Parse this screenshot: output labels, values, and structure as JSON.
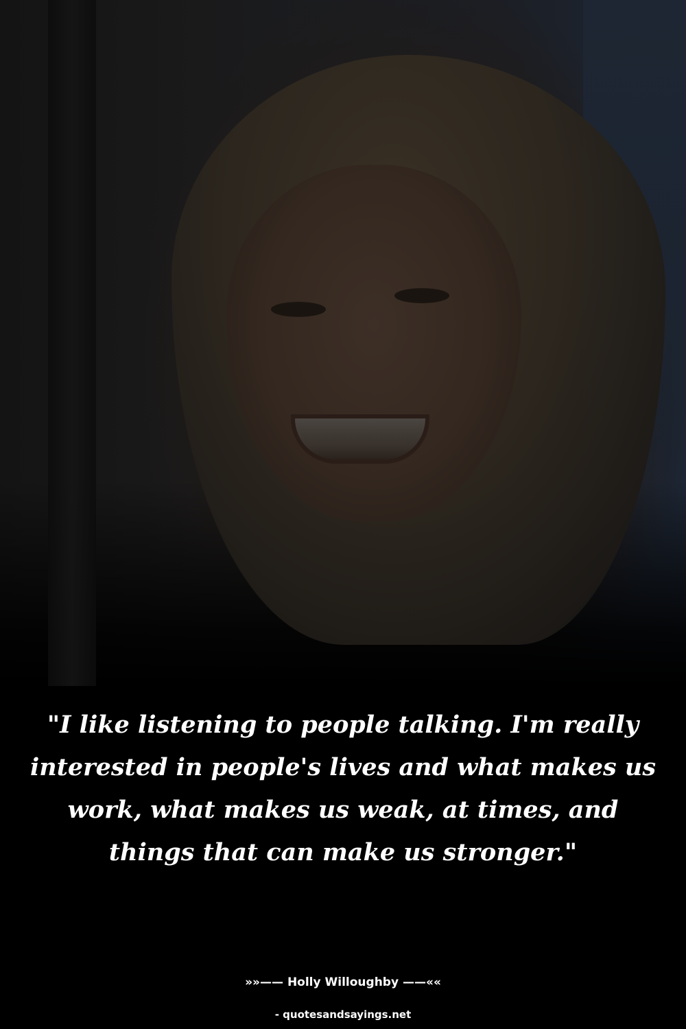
{
  "quote": {
    "text": "\"I like listening to people talking. I'm really interested in people's lives and what makes us work, what makes us weak, at times, and things that can make us stronger.\""
  },
  "author": {
    "line": "»»—— Holly Willoughby ——««"
  },
  "source": {
    "text": "- quotesandsayings.net"
  },
  "colors": {
    "background": "#000000",
    "text": "#ffffff"
  }
}
